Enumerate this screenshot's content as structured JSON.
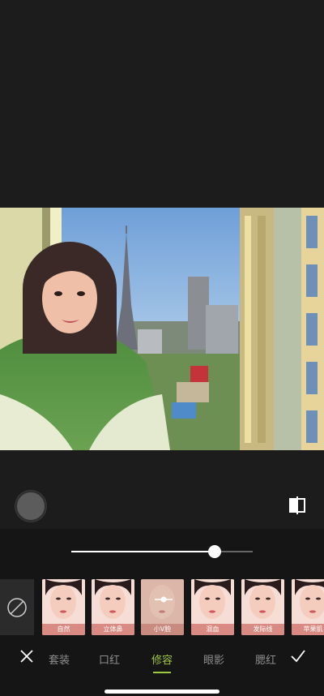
{
  "colors": {
    "accent": "#9ec83e",
    "background": "#1c1c1c",
    "card_label": "#d98a82"
  },
  "slider": {
    "value_percent": 79
  },
  "styles": [
    {
      "label": "自然",
      "selected": false
    },
    {
      "label": "立体鼻",
      "selected": false
    },
    {
      "label": "小V脸",
      "selected": true
    },
    {
      "label": "混血",
      "selected": false
    },
    {
      "label": "发际线",
      "selected": false
    },
    {
      "label": "苹果肌",
      "selected": false
    }
  ],
  "tabs": [
    {
      "label": "套装",
      "active": false
    },
    {
      "label": "口红",
      "active": false
    },
    {
      "label": "修容",
      "active": true
    },
    {
      "label": "眼影",
      "active": false
    },
    {
      "label": "腮红",
      "active": false
    }
  ],
  "icons": {
    "close": "close-icon",
    "confirm": "check-icon",
    "none": "none-icon",
    "compare": "compare-icon"
  }
}
